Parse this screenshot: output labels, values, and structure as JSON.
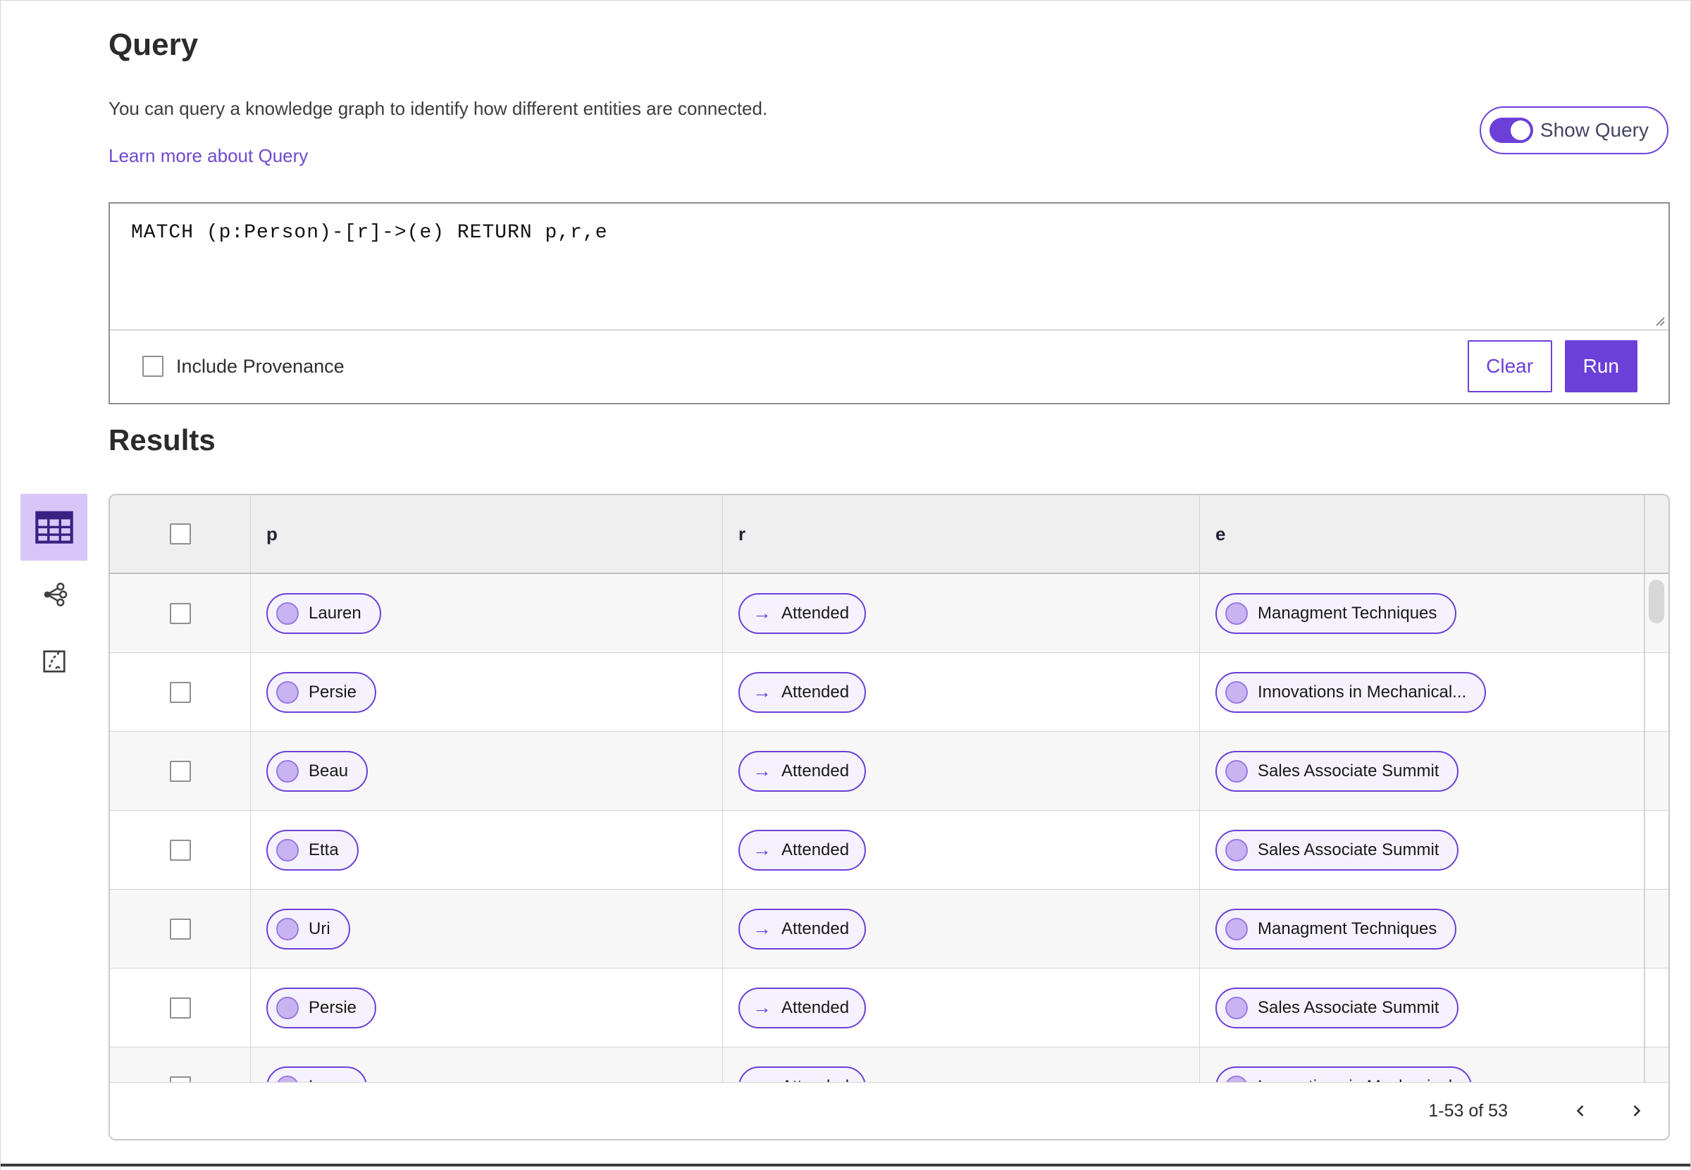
{
  "colors": {
    "accent_purple": "#6c40d8",
    "pill_background": "#f5f2fd",
    "node_circle_fill": "#c9b4f1",
    "selected_view_background": "#d9c6f9",
    "table_header_background": "#efefef",
    "row_stripe_background": "#f7f7f7"
  },
  "icons": {
    "view_rail": [
      "table-icon",
      "network-graph-icon",
      "route-map-icon"
    ],
    "relation_arrow": "arrow-right-icon",
    "pagination": [
      "chevron-left-icon",
      "chevron-right-icon"
    ],
    "textarea": "resize-handle-icon",
    "toggle": "toggle-switch-icon"
  },
  "query_panel": {
    "title": "Query",
    "description": "You can query a knowledge graph to identify how different entities are connected.",
    "learn_more": "Learn more about Query",
    "show_query": {
      "label": "Show Query",
      "enabled": true
    },
    "editor": {
      "query_text": "MATCH (p:Person)-[r]->(e) RETURN p,r,e",
      "include_provenance": {
        "label": "Include Provenance",
        "checked": false
      },
      "clear_label": "Clear",
      "run_label": "Run"
    }
  },
  "results_panel": {
    "title": "Results",
    "view_rail": [
      {
        "id": "table-view",
        "selected": true
      },
      {
        "id": "graph-view",
        "selected": false
      },
      {
        "id": "map-view",
        "selected": false
      }
    ],
    "table": {
      "columns": [
        "p",
        "r",
        "e"
      ],
      "relation_arrow": "→",
      "rows": [
        {
          "p": "Lauren",
          "r": "Attended",
          "e": "Managment Techniques"
        },
        {
          "p": "Persie",
          "r": "Attended",
          "e": "Innovations in Mechanical..."
        },
        {
          "p": "Beau",
          "r": "Attended",
          "e": "Sales Associate Summit"
        },
        {
          "p": "Etta",
          "r": "Attended",
          "e": "Sales Associate Summit"
        },
        {
          "p": "Uri",
          "r": "Attended",
          "e": "Managment Techniques"
        },
        {
          "p": "Persie",
          "r": "Attended",
          "e": "Sales Associate Summit"
        },
        {
          "p": "Larry",
          "r": "Attended",
          "e": "Innovations in Mechanical"
        }
      ]
    },
    "pagination": {
      "range": "1-53 of 53"
    }
  }
}
